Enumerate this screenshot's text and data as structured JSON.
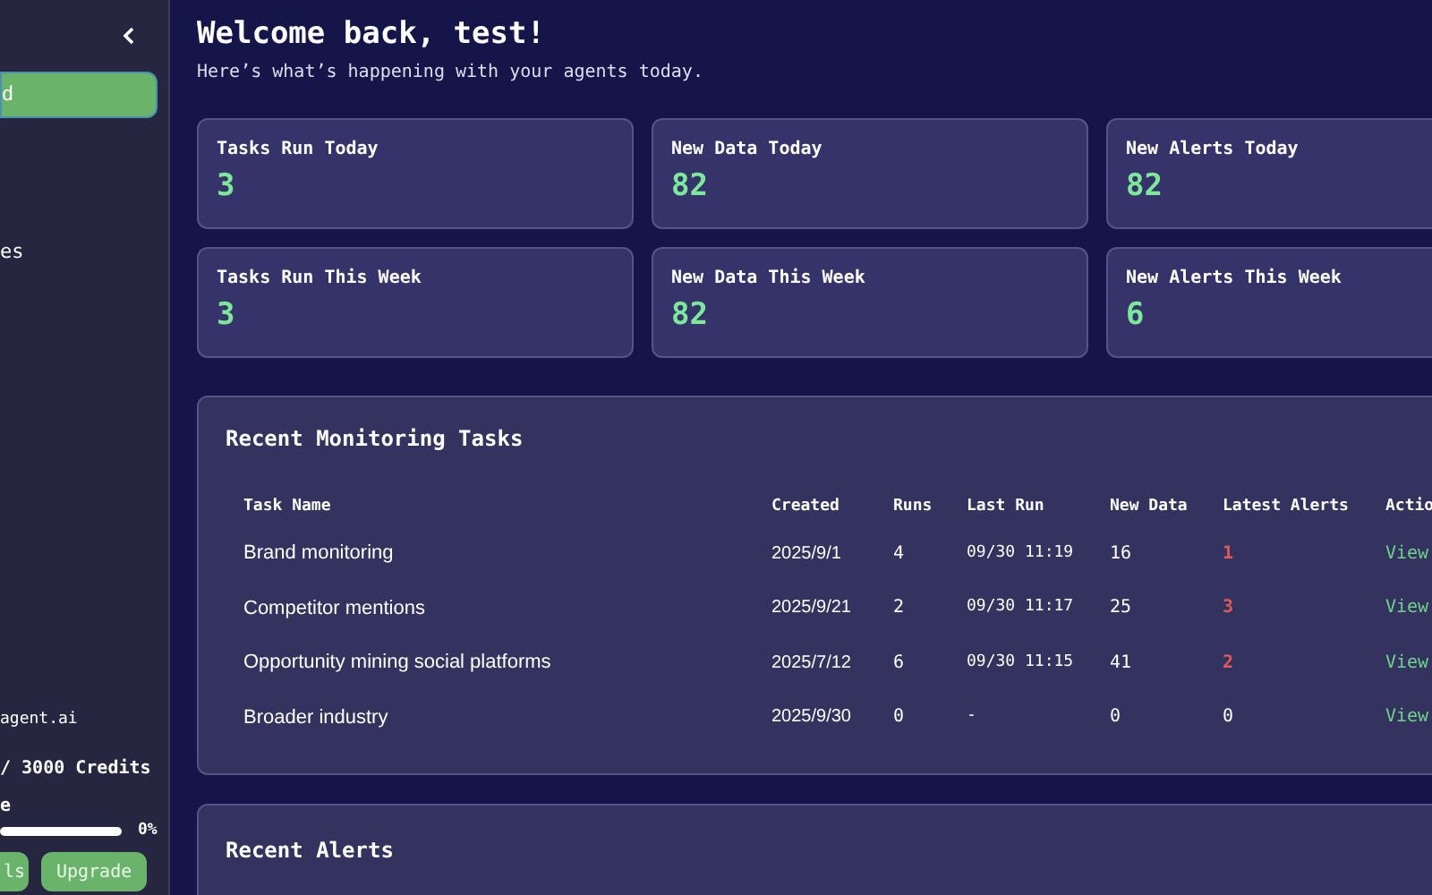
{
  "sidebar": {
    "items": [
      {
        "label": "d",
        "selected": true
      },
      {
        "label": "es",
        "selected": false
      }
    ],
    "footer": {
      "site": "agent.ai",
      "credits": "/ 3000 Credits",
      "usage_label": "e",
      "usage": {
        "level": 0,
        "reading": "0%"
      },
      "buttons": [
        "ls",
        "Upgrade"
      ]
    }
  },
  "header": {
    "title": "Welcome back, test!",
    "subtitle": "Here’s what’s happening with your agents today."
  },
  "stats": [
    {
      "label": "Tasks Run Today",
      "value": "3"
    },
    {
      "label": "New Data Today",
      "value": "82"
    },
    {
      "label": "New Alerts Today",
      "value": "82"
    },
    {
      "label": "Tasks Run This Week",
      "value": "3"
    },
    {
      "label": "New Data This Week",
      "value": "82"
    },
    {
      "label": "New Alerts This Week",
      "value": "6"
    }
  ],
  "tasks": {
    "title": "Recent Monitoring Tasks",
    "columns": [
      "Task Name",
      "Created",
      "Runs",
      "Last Run",
      "New Data",
      "Latest Alerts",
      "Actio"
    ],
    "rows": [
      {
        "name": "Brand monitoring",
        "created": "2025/9/1",
        "runs": "4",
        "last_run": "09/30 11:19",
        "new_data": "16",
        "alerts": "1",
        "alerting": true,
        "action": "View"
      },
      {
        "name": "Competitor mentions",
        "created": "2025/9/21",
        "runs": "2",
        "last_run": "09/30 11:17",
        "new_data": "25",
        "alerts": "3",
        "alerting": true,
        "action": "View"
      },
      {
        "name": "Opportunity mining social platforms",
        "created": "2025/7/12",
        "runs": "6",
        "last_run": "09/30 11:15",
        "new_data": "41",
        "alerts": "2",
        "alerting": true,
        "action": "View"
      },
      {
        "name": "Broader industry",
        "created": "2025/9/30",
        "runs": "0",
        "last_run": "-",
        "new_data": "0",
        "alerts": "0",
        "alerting": false,
        "action": "View"
      }
    ]
  },
  "alerts": {
    "title": "Recent Alerts"
  }
}
